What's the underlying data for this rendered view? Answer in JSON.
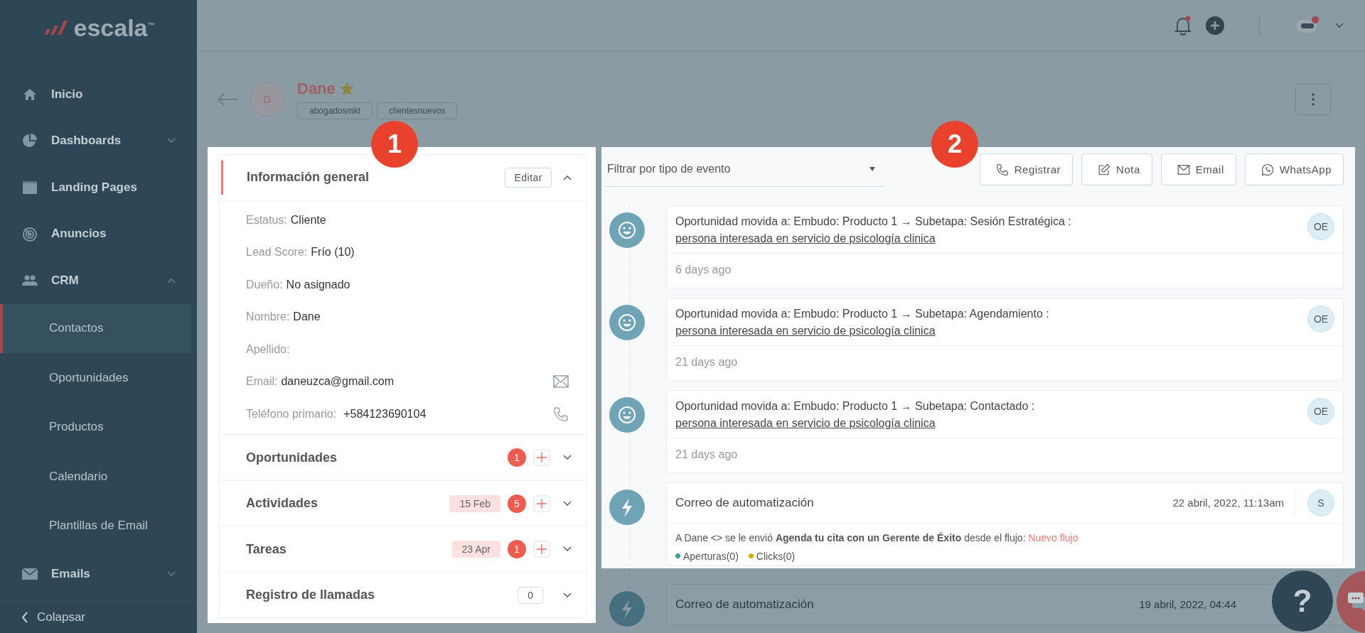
{
  "sidebar": {
    "logo": {
      "text": "escala",
      "trademark": "™"
    },
    "items": [
      {
        "label": "Inicio",
        "selected": false
      },
      {
        "label": "Dashboards",
        "selected": false,
        "expanded": false
      },
      {
        "label": "Landing Pages",
        "selected": false
      },
      {
        "label": "Anuncios",
        "selected": false
      },
      {
        "label": "CRM",
        "selected": false,
        "expanded": true,
        "children": [
          {
            "label": "Contactos",
            "selected": true
          },
          {
            "label": "Oportunidades",
            "selected": false
          },
          {
            "label": "Productos",
            "selected": false
          },
          {
            "label": "Calendario",
            "selected": false
          },
          {
            "label": "Plantillas de Email",
            "selected": false
          }
        ]
      },
      {
        "label": "Emails",
        "selected": false,
        "expanded": false
      }
    ],
    "collapse": {
      "label": "Colapsar"
    }
  },
  "topbar": {
    "notifications": {
      "unread": true
    }
  },
  "contact": {
    "avatar_initial": "D",
    "name": "Dane",
    "starred": true,
    "tags": [
      "abogadosmkt",
      "clientesnuevos"
    ]
  },
  "tour_steps": [
    "1",
    "2"
  ],
  "info_panel": {
    "title": "Información general",
    "edit_button": "Editar",
    "expanded": true,
    "fields": [
      {
        "label": "Estatus:",
        "value": "Cliente",
        "kind": "text"
      },
      {
        "label": "Lead Score:",
        "value": "Frío (10)",
        "kind": "text"
      },
      {
        "label": "Dueño:",
        "value": "No asignado",
        "kind": "text"
      },
      {
        "label": "Nombre:",
        "value": "Dane",
        "kind": "text"
      },
      {
        "label": "Apellido:",
        "kind": "text"
      },
      {
        "label": "Email:",
        "value": "daneuzca@gmail.com",
        "kind": "email"
      },
      {
        "label": "Teléfono primario:",
        "value": "+584123690104",
        "kind": "phone"
      }
    ],
    "sections": [
      {
        "title": "Oportunidades",
        "count": "1",
        "kind": "badge",
        "expanded": false
      },
      {
        "title": "Actividades",
        "date": "15 Feb",
        "count": "5",
        "kind": "badge",
        "expanded": false
      },
      {
        "title": "Tareas",
        "date": "23 Apr",
        "count": "1",
        "kind": "badge",
        "expanded": false
      },
      {
        "title": "Registro de llamadas",
        "count": "0",
        "kind": "outline",
        "expanded": false
      }
    ]
  },
  "timeline": {
    "filter": {
      "placeholder": "Filtrar por tipo de evento"
    },
    "actions": [
      {
        "label": "Registrar"
      },
      {
        "label": "Nota"
      },
      {
        "label": "Email"
      },
      {
        "label": "WhatsApp"
      }
    ],
    "events": [
      {
        "kind": "stage",
        "dimmed": false,
        "text": "Oportunidad movida a: Embudo: Producto 1 → Subetapa: Sesión Estratégica : ",
        "link": "persona interesada en servicio de psicología clinica",
        "time": "6 days ago",
        "user": "OE"
      },
      {
        "kind": "stage",
        "dimmed": false,
        "text": "Oportunidad movida a: Embudo: Producto 1 → Subetapa: Agendamiento : ",
        "link": "persona interesada en servicio de psicología clinica",
        "time": "21 days ago",
        "user": "OE"
      },
      {
        "kind": "stage",
        "dimmed": false,
        "text": "Oportunidad movida a: Embudo: Producto 1 → Subetapa: Contactado : ",
        "link": "persona interesada en servicio de psicología clinica",
        "time": "21 days ago",
        "user": "OE"
      },
      {
        "kind": "email",
        "dimmed": false,
        "title": "Correo de automatización",
        "date": "22 abril, 2022, 11:13am",
        "user": "S",
        "body": "A Dane <> se le envió **Agenda tu cita con un Gerente de Éxito** desde el flujo: ",
        "link": "Nuevo flujo",
        "stats": [
          {
            "label": "Aperturas(0)",
            "color": "#3aa39a"
          },
          {
            "label": "Clicks(0)",
            "color": "#e0a800"
          }
        ]
      },
      {
        "kind": "email",
        "dimmed": true,
        "title": "Correo de automatización",
        "date": "19 abril, 2022, 04:44"
      }
    ]
  },
  "help": {
    "label": "?"
  }
}
